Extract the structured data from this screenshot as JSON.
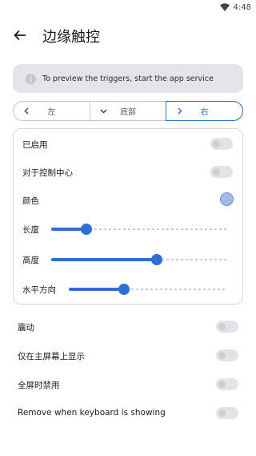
{
  "status_bar": {
    "time": "4:48"
  },
  "app_bar": {
    "title": "边缘触控"
  },
  "info": {
    "text": "To preview the triggers, start the app service"
  },
  "segments": [
    {
      "label": "左",
      "icon": "chevron-left-icon",
      "selected": false
    },
    {
      "label": "底部",
      "icon": "chevron-down-icon",
      "selected": false
    },
    {
      "label": "右",
      "icon": "chevron-right-icon",
      "selected": true
    }
  ],
  "settings": {
    "enabled": {
      "label": "已启用",
      "on": false
    },
    "control_center": {
      "label": "对于控制中心",
      "on": false
    },
    "color": {
      "label": "颜色",
      "value": "#a4b9e8"
    },
    "length": {
      "label": "长度",
      "level_fraction": 0.2
    },
    "height": {
      "label": "高度",
      "level_fraction": 0.6
    },
    "horizontal": {
      "label": "水平方向",
      "level_fraction": 0.35
    }
  },
  "options": {
    "vibrate": {
      "label": "震动",
      "on": false
    },
    "home_only": {
      "label": "仅在主屏幕上显示",
      "on": false
    },
    "fullscreen_disable": {
      "label": "全屏时禁用",
      "on": false
    },
    "keyboard_remove": {
      "label": "Remove when keyboard is showing",
      "on": false
    }
  },
  "colors": {
    "accent": "#2e6fd6",
    "info_bg": "#e5e5e9"
  }
}
